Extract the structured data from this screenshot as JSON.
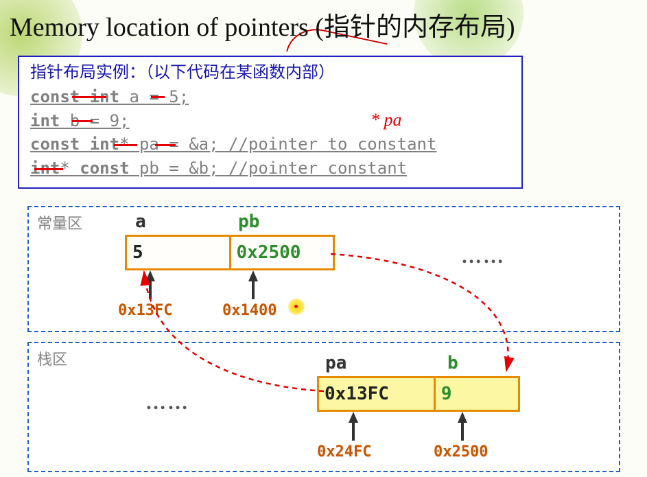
{
  "title": "Memory location of pointers (指针的内存布局)",
  "code": {
    "header": "指针布局实例：（以下代码在某函数内部）",
    "line1_kw": "const int",
    "line1_rest": " a = 5;",
    "line2_kw": "int",
    "line2_rest": " b = 9;",
    "line3_kw": "const int",
    "line3_star_name": "* pa = &a;",
    "line3_comment": " //pointer to constant",
    "line4_kw": "int",
    "line4_mid": "* ",
    "line4_kw2": "const",
    "line4_name": " pb = &b;",
    "line4_comment": " //pointer constant",
    "hand_note": "* pa"
  },
  "const_region": {
    "label": "常量区",
    "var_a": "a",
    "var_pb": "pb",
    "val_a": "5",
    "val_pb": "0x2500",
    "addr_a": "0x13FC",
    "addr_pb": "0x1400",
    "dots": "……"
  },
  "stack_region": {
    "label": "栈区",
    "var_pa": "pa",
    "var_b": "b",
    "val_pa": "0x13FC",
    "val_b": "9",
    "addr_pa": "0x24FC",
    "addr_b": "0x2500",
    "dots": "……"
  }
}
